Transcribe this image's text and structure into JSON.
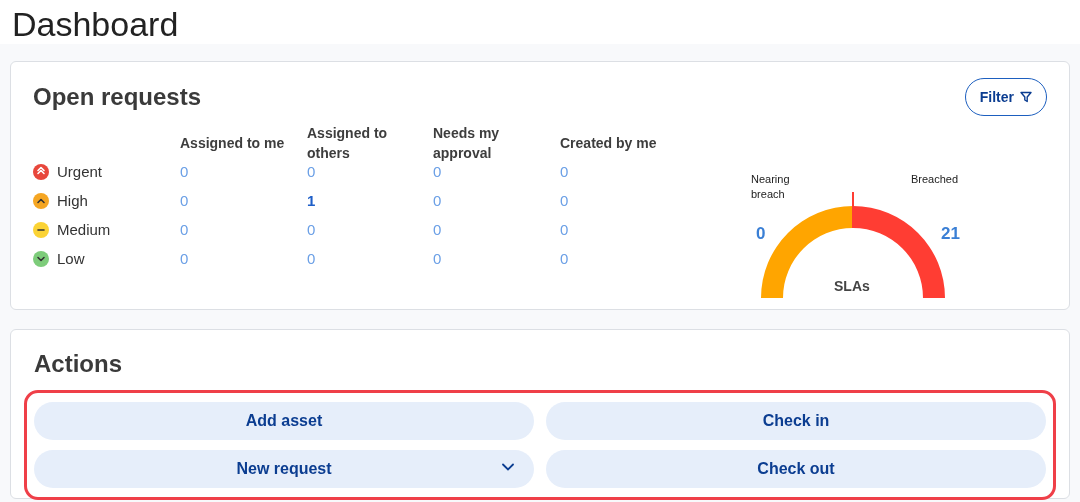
{
  "page": {
    "title": "Dashboard"
  },
  "open_requests": {
    "title": "Open requests",
    "filter_button": "Filter",
    "columns": [
      "Assigned to me",
      "Assigned to others",
      "Needs my approval",
      "Created by me"
    ],
    "rows": [
      {
        "priority": "Urgent",
        "color": "#e8473c",
        "kind": "double-up",
        "cells": [
          {
            "value": "0",
            "emphasis": false
          },
          {
            "value": "0",
            "emphasis": false
          },
          {
            "value": "0",
            "emphasis": false
          },
          {
            "value": "0",
            "emphasis": false
          }
        ]
      },
      {
        "priority": "High",
        "color": "#f5a623",
        "kind": "up",
        "cells": [
          {
            "value": "0",
            "emphasis": false
          },
          {
            "value": "1",
            "emphasis": true
          },
          {
            "value": "0",
            "emphasis": false
          },
          {
            "value": "0",
            "emphasis": false
          }
        ]
      },
      {
        "priority": "Medium",
        "color": "#fbd335",
        "kind": "dash",
        "cells": [
          {
            "value": "0",
            "emphasis": false
          },
          {
            "value": "0",
            "emphasis": false
          },
          {
            "value": "0",
            "emphasis": false
          },
          {
            "value": "0",
            "emphasis": false
          }
        ]
      },
      {
        "priority": "Low",
        "color": "#7dcc7a",
        "kind": "down",
        "cells": [
          {
            "value": "0",
            "emphasis": false
          },
          {
            "value": "0",
            "emphasis": false
          },
          {
            "value": "0",
            "emphasis": false
          },
          {
            "value": "0",
            "emphasis": false
          }
        ]
      }
    ],
    "sla_gauge": {
      "title": "SLAs",
      "left_label": "Nearing breach",
      "left_value": "0",
      "right_label": "Breached",
      "right_value": "21"
    }
  },
  "actions": {
    "title": "Actions",
    "highlighted": true,
    "buttons": [
      {
        "label": "Add asset",
        "dropdown": false
      },
      {
        "label": "Check in",
        "dropdown": false
      },
      {
        "label": "New request",
        "dropdown": true
      },
      {
        "label": "Check out",
        "dropdown": false
      }
    ]
  }
}
